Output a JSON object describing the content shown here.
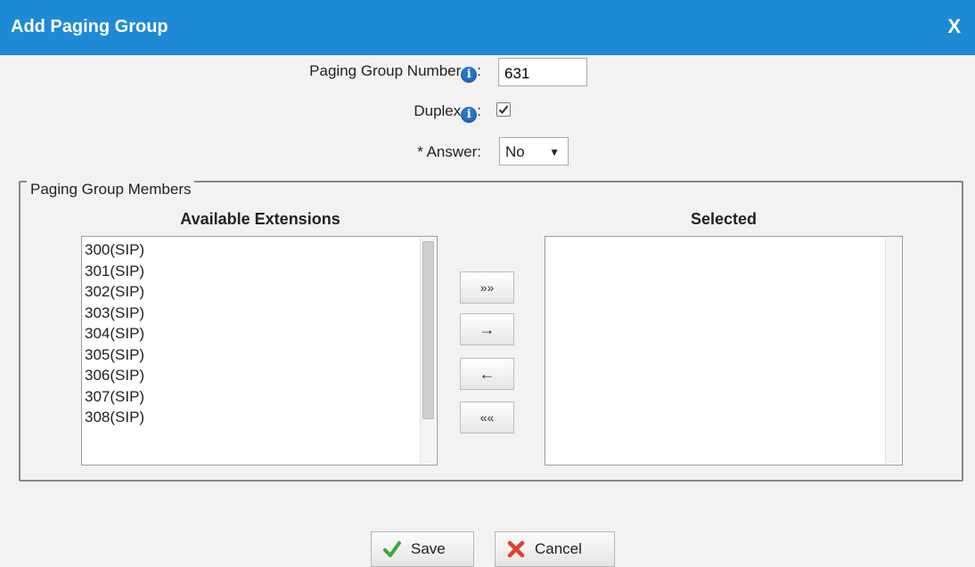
{
  "dialog": {
    "title": "Add Paging Group",
    "close_label": "X"
  },
  "form": {
    "group_number_label": "Paging Group Number",
    "group_number_suffix": ":",
    "group_number_value": "631",
    "duplex_label": "Duplex",
    "duplex_suffix": ":",
    "duplex_checked": true,
    "answer_label": "* Answer:",
    "answer_value": "No"
  },
  "members": {
    "legend": "Paging Group Members",
    "available_header": "Available Extensions",
    "selected_header": "Selected",
    "available_items": [
      "300(SIP)",
      "301(SIP)",
      "302(SIP)",
      "303(SIP)",
      "304(SIP)",
      "305(SIP)",
      "306(SIP)",
      "307(SIP)",
      "308(SIP)"
    ],
    "selected_items": [],
    "move_all_right": "»»",
    "move_right": "→",
    "move_left": "←",
    "move_all_left": "««"
  },
  "actions": {
    "save_label": "Save",
    "cancel_label": "Cancel"
  },
  "icons": {
    "info": "info-icon",
    "save": "check-icon",
    "cancel": "x-icon"
  },
  "colors": {
    "titlebar": "#1e8ad6",
    "info": "#2a75c7",
    "check": "#3aa83a",
    "cancel": "#e04030"
  }
}
